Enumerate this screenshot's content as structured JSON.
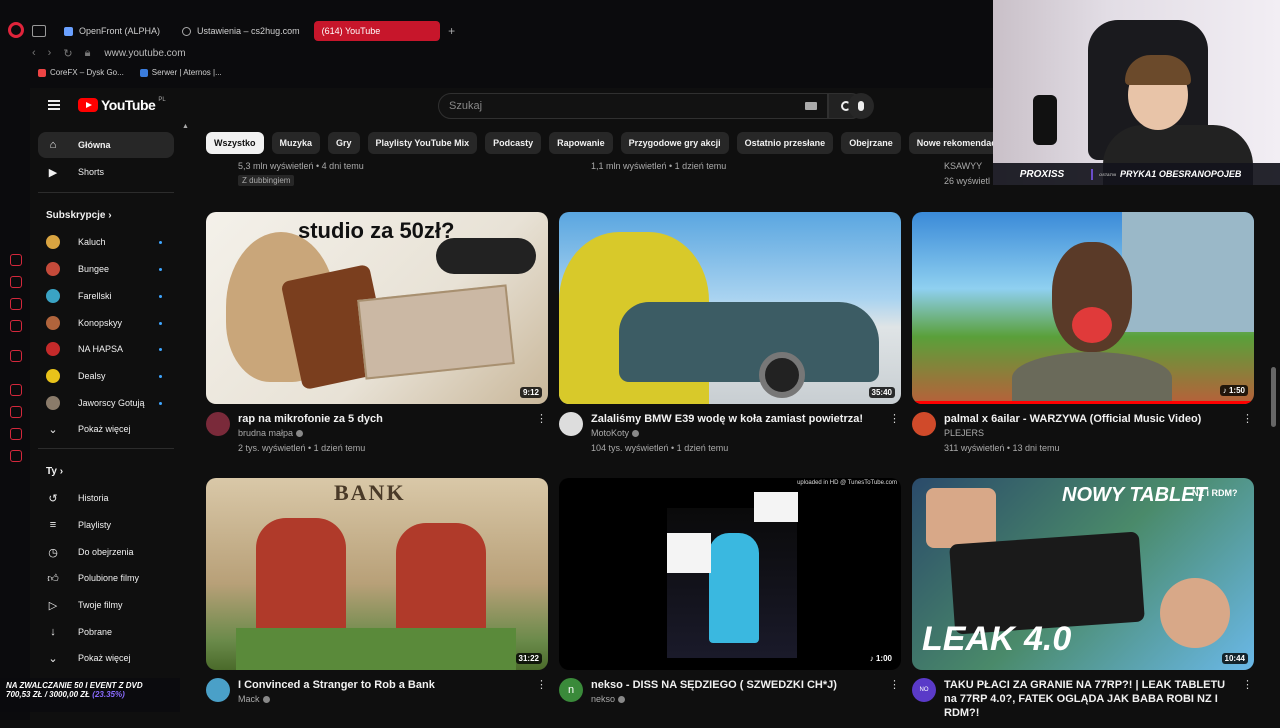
{
  "browser": {
    "tabs": [
      {
        "label": "OpenFront (ALPHA)"
      },
      {
        "label": "Ustawienia – cs2hug.com"
      },
      {
        "label": "(614) YouTube"
      }
    ],
    "url": "www.youtube.com",
    "bookmarks": [
      "CoreFX – Dysk Go...",
      "Serwer | Aternos |..."
    ],
    "accent": "#c7162b"
  },
  "yt": {
    "logo_text": "YouTube",
    "region": "PL",
    "search_placeholder": "Szukaj",
    "sidebar": {
      "main": [
        {
          "label": "Główna",
          "icon": "home-icon",
          "active": true
        },
        {
          "label": "Shorts",
          "icon": "shorts-icon",
          "active": false
        }
      ],
      "subs_heading": "Subskrypcje",
      "subs": [
        {
          "label": "Kaluch",
          "color": "#d9a441"
        },
        {
          "label": "Bungee",
          "color": "#c44a3a"
        },
        {
          "label": "Farellski",
          "color": "#3aa3c4"
        },
        {
          "label": "Konopskyy",
          "color": "#b0643c"
        },
        {
          "label": "NA HAPSA",
          "color": "#c42a2a"
        },
        {
          "label": "Dealsy",
          "color": "#e8c21a"
        },
        {
          "label": "Jaworscy Gotują",
          "color": "#8a7b6a"
        }
      ],
      "show_more": "Pokaż więcej",
      "you_heading": "Ty",
      "you": [
        {
          "label": "Historia",
          "icon": "history-icon"
        },
        {
          "label": "Playlisty",
          "icon": "playlists-icon"
        },
        {
          "label": "Do obejrzenia",
          "icon": "watch-later-icon"
        },
        {
          "label": "Polubione filmy",
          "icon": "liked-icon"
        },
        {
          "label": "Twoje filmy",
          "icon": "your-videos-icon"
        },
        {
          "label": "Pobrane",
          "icon": "downloads-icon"
        }
      ],
      "you_more": "Pokaż więcej"
    },
    "chips": [
      "Wszystko",
      "Muzyka",
      "Gry",
      "Playlisty YouTube Mix",
      "Podcasty",
      "Rapowanie",
      "Przygodowe gry akcji",
      "Ostatnio przesłane",
      "Obejrzane",
      "Nowe rekomendacje"
    ],
    "prev_row": {
      "col1": "5,3 mln wyświetleń • 4 dni temu",
      "col2": "1,1 mln wyświetleń • 1 dzień temu",
      "col3_channel": "KSAWYY",
      "col3_stats": "26 wyświetl",
      "dub": "Z dubbingiem"
    },
    "videos": [
      {
        "title": "rap na mikrofonie za 5 dych",
        "channel": "brudna małpa",
        "stats": "2 tys. wyświetleń • 1 dzień temu",
        "duration": "9:12",
        "thumb_text": "studio za 50zł?",
        "avatar": "#7a2a3a",
        "verified": true
      },
      {
        "title": "Zalaliśmy BMW E39 wodę w koła zamiast powietrza!",
        "channel": "MotoKoty",
        "stats": "104 tys. wyświetleń • 1 dzień temu",
        "duration": "35:40",
        "avatar": "#dddddd",
        "verified": true
      },
      {
        "title": "palmal x 6ailar - WARZYWA (Official Music Video)",
        "channel": "PLEJERS",
        "stats": "311 wyświetleń • 13 dni temu",
        "duration": "1:50",
        "avatar": "#d04a2a",
        "verified": false
      },
      {
        "title": "I Convinced a Stranger to Rob a Bank",
        "channel": "Mack",
        "stats": "",
        "duration": "31:22",
        "thumb_text": "BANK",
        "avatar": "#4aa0c8",
        "verified": true
      },
      {
        "title": "nekso - DISS NA SĘDZIEGO ( SZWEDZKI CH*J)",
        "channel": "nekso",
        "stats": "",
        "duration": "1:00",
        "thumb_text": "uploaded in HD @ TunesToTube.com",
        "avatar": "#3a8a3a",
        "avatar_letter": "n",
        "verified": true
      },
      {
        "title": "TAKU PŁACI ZA GRANIE NA 77RP?! | LEAK TABLETU na 77RP 4.0?, FATEK OGLĄDA JAK BABA ROBI NZ I RDM?!",
        "channel": "",
        "stats": "",
        "duration": "10:44",
        "thumb_text": "NOWY TABLET",
        "thumb_text2": "LEAK 4.0",
        "thumb_text3": "NZ i RDM?",
        "avatar": "#5a3ac8",
        "avatar_letter": "NO",
        "verified": false
      }
    ]
  },
  "overlay": {
    "streamer": "PROXISS",
    "last_label": "OSTATNI",
    "last_donor": "PRYKA1 OBESRANOPOJEB",
    "donation_line1": "NA ZWALCZANIE 50 I EVENT Z DVD",
    "donation_amount": "700,53 ZŁ / 3000,00 ZŁ",
    "donation_pct": "(23.35%)"
  }
}
